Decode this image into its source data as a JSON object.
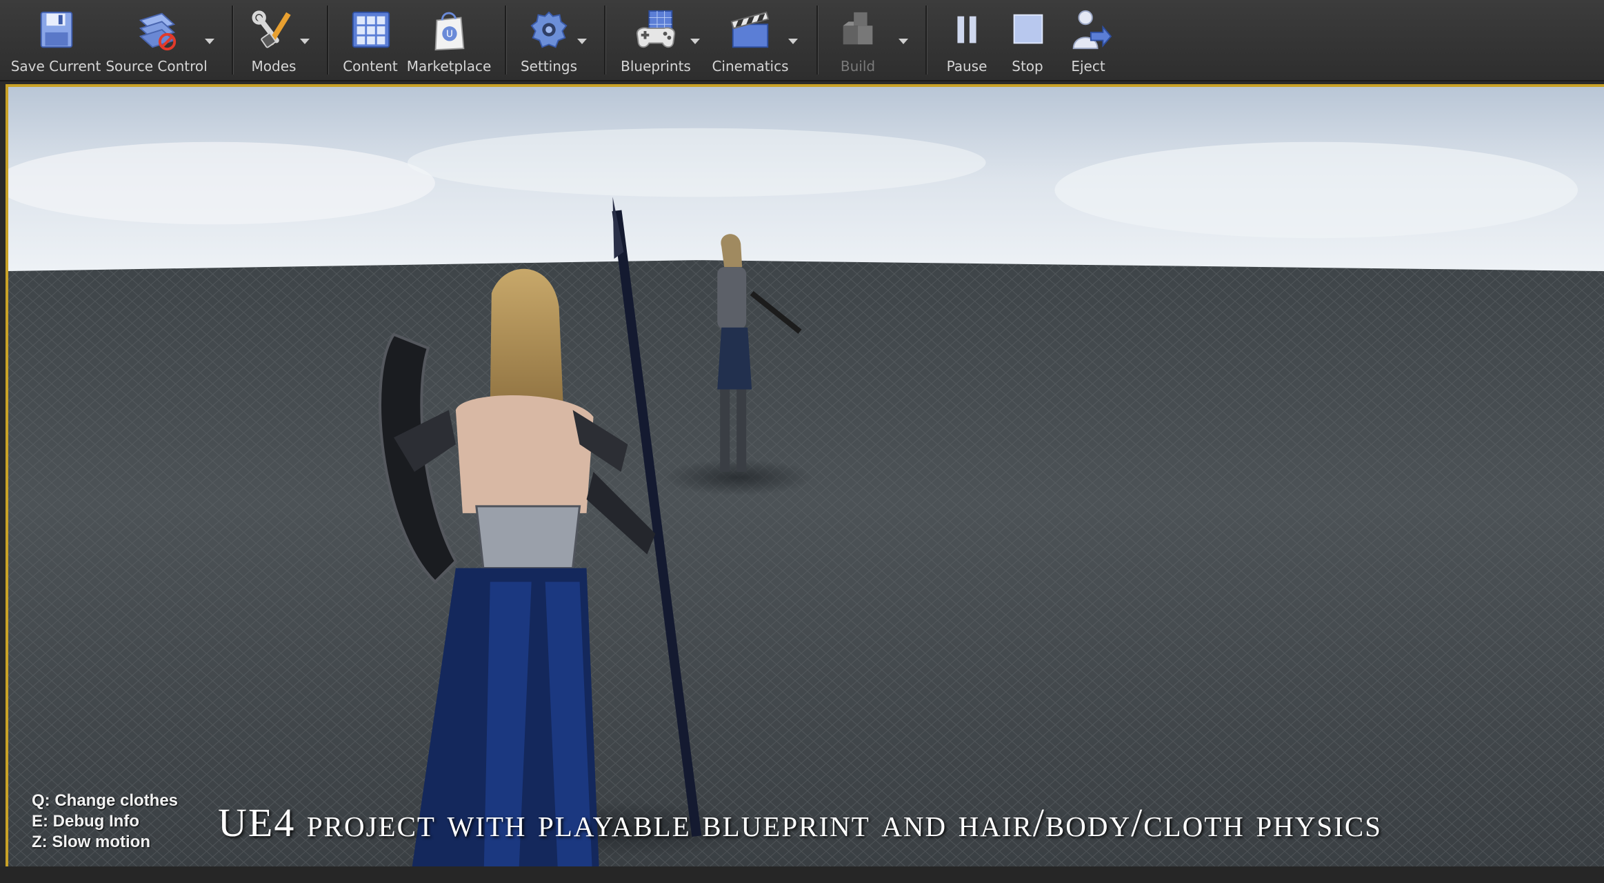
{
  "toolbar": {
    "save_current": "Save Current",
    "source_control": "Source Control",
    "modes": "Modes",
    "content": "Content",
    "marketplace": "Marketplace",
    "settings": "Settings",
    "blueprints": "Blueprints",
    "cinematics": "Cinematics",
    "build": "Build",
    "pause": "Pause",
    "stop": "Stop",
    "eject": "Eject"
  },
  "icons": {
    "save_current": "floppy-disk-icon",
    "source_control": "source-control-icon",
    "modes": "wrench-pencil-icon",
    "content": "content-grid-icon",
    "marketplace": "shopping-bag-icon",
    "settings": "gear-icon",
    "blueprints": "gamepad-icon",
    "cinematics": "clapperboard-icon",
    "build": "build-blocks-icon",
    "pause": "pause-icon",
    "stop": "stop-icon",
    "eject": "eject-icon"
  },
  "viewport": {
    "help_lines": [
      "Q: Change clothes",
      "E: Debug Info",
      "Z: Slow motion"
    ],
    "caption": "UE4 project with playable blueprint and hair/body/cloth physics"
  },
  "colors": {
    "viewport_border": "#c9a227",
    "toolbar_bg": "#353535"
  }
}
